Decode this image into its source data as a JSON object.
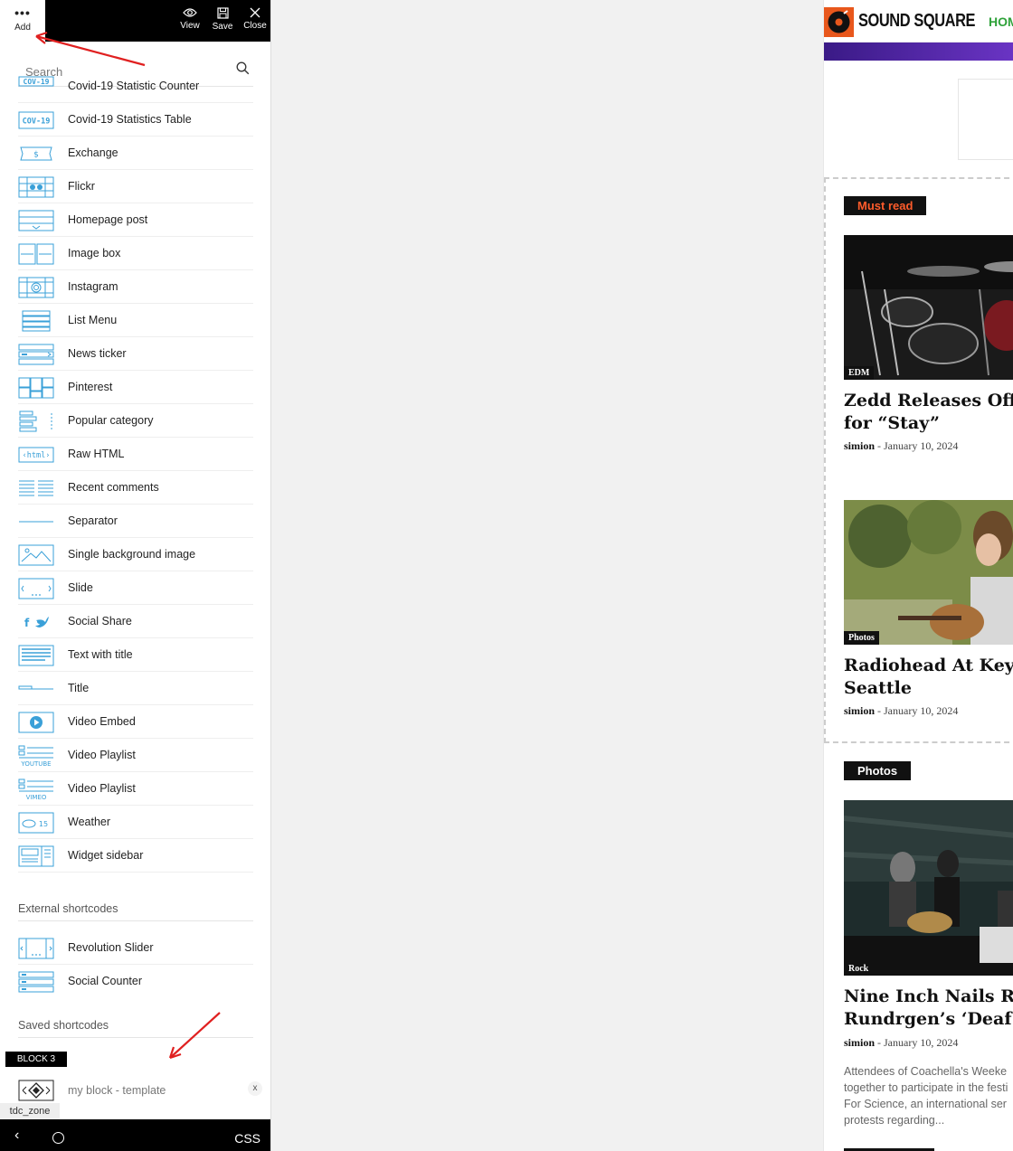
{
  "toolbar": {
    "add_label": "Add",
    "view_label": "View",
    "save_label": "Save",
    "close_label": "Close"
  },
  "search": {
    "placeholder": "Search",
    "value": ""
  },
  "elements": [
    {
      "label": "Covid-19 Statistic Counter",
      "icon": "covid-counter-icon"
    },
    {
      "label": "Covid-19 Statistics Table",
      "icon": "covid-table-icon"
    },
    {
      "label": "Exchange",
      "icon": "exchange-icon"
    },
    {
      "label": "Flickr",
      "icon": "flickr-icon"
    },
    {
      "label": "Homepage post",
      "icon": "homepage-post-icon"
    },
    {
      "label": "Image box",
      "icon": "image-box-icon"
    },
    {
      "label": "Instagram",
      "icon": "instagram-icon"
    },
    {
      "label": "List Menu",
      "icon": "list-menu-icon"
    },
    {
      "label": "News ticker",
      "icon": "news-ticker-icon"
    },
    {
      "label": "Pinterest",
      "icon": "pinterest-icon"
    },
    {
      "label": "Popular category",
      "icon": "popular-category-icon"
    },
    {
      "label": "Raw HTML",
      "icon": "raw-html-icon"
    },
    {
      "label": "Recent comments",
      "icon": "recent-comments-icon"
    },
    {
      "label": "Separator",
      "icon": "separator-icon"
    },
    {
      "label": "Single background image",
      "icon": "background-image-icon"
    },
    {
      "label": "Slide",
      "icon": "slide-icon"
    },
    {
      "label": "Social Share",
      "icon": "social-share-icon"
    },
    {
      "label": "Text with title",
      "icon": "text-with-title-icon"
    },
    {
      "label": "Title",
      "icon": "title-icon"
    },
    {
      "label": "Video Embed",
      "icon": "video-embed-icon"
    },
    {
      "label": "Video Playlist",
      "icon": "youtube-playlist-icon",
      "sub": "YOUTUBE"
    },
    {
      "label": "Video Playlist",
      "icon": "vimeo-playlist-icon",
      "sub": "VIMEO"
    },
    {
      "label": "Weather",
      "icon": "weather-icon",
      "sub": "15"
    },
    {
      "label": "Widget sidebar",
      "icon": "widget-sidebar-icon"
    }
  ],
  "external": {
    "heading": "External shortcodes",
    "items": [
      {
        "label": "Revolution Slider",
        "icon": "revolution-slider-icon"
      },
      {
        "label": "Social Counter",
        "icon": "social-counter-icon"
      }
    ]
  },
  "saved": {
    "heading": "Saved shortcodes",
    "badge": "BLOCK 3",
    "item_label": "my block - template",
    "delete_label": "x"
  },
  "zone_label": "tdc_zone",
  "bottom": {
    "back": "‹",
    "css_label": "CSS"
  },
  "site": {
    "name": "SOUND SQUARE",
    "nav_first": "HOM",
    "accent": "#e8571c",
    "sections": [
      {
        "badge": "Must read",
        "badge_color": "#ff5c2b"
      },
      {
        "badge": "Photos",
        "badge_color": "#ffffff"
      }
    ],
    "posts": [
      {
        "category": "EDM",
        "title_line1": "Zedd Releases Offic",
        "title_line2": "for “Stay”",
        "author": "simion",
        "date": "January 10, 2024"
      },
      {
        "category": "Photos",
        "title_line1": "Radiohead At KeyAr",
        "title_line2": "Seattle",
        "author": "simion",
        "date": "January 10, 2024"
      },
      {
        "category": "Rock",
        "title_line1": "Nine Inch Nails Rem",
        "title_line2": "Rundrgen’s ‘Deaf Ea",
        "author": "simion",
        "date": "January 10, 2024",
        "excerpt": [
          "Attendees of Coachella's Weeke",
          "together to participate in the festi",
          "For Science, an international ser",
          "protests regarding..."
        ]
      }
    ]
  }
}
